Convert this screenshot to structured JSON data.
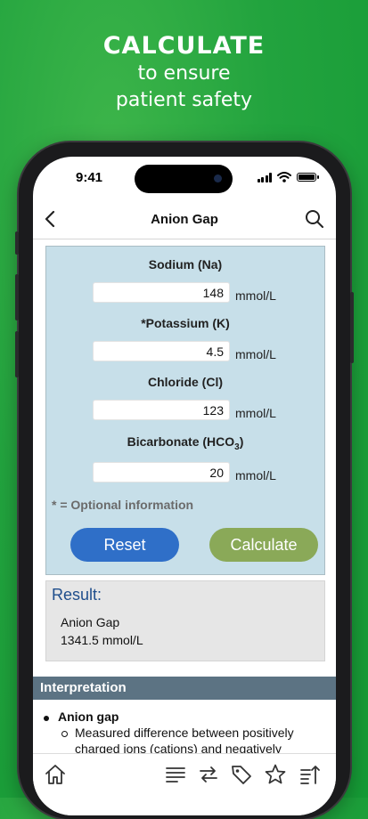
{
  "promo": {
    "headline": "CALCULATE",
    "line1": "to ensure",
    "line2": "patient safety"
  },
  "status_bar": {
    "time": "9:41"
  },
  "nav": {
    "title": "Anion Gap",
    "back_icon": "chevron-left-icon",
    "search_icon": "search-icon"
  },
  "form": {
    "fields": [
      {
        "label": "Sodium (Na)",
        "value": "148",
        "unit": "mmol/L"
      },
      {
        "label": "*Potassium (K)",
        "value": "4.5",
        "unit": "mmol/L"
      },
      {
        "label": "Chloride (Cl)",
        "value": "123",
        "unit": "mmol/L"
      },
      {
        "label": "Bicarbonate (HCO",
        "label_sub": "3",
        "label_end": ")",
        "value": "20",
        "unit": "mmol/L"
      }
    ],
    "optional_note": "* = Optional information",
    "reset_label": "Reset",
    "calculate_label": "Calculate",
    "colors": {
      "panel": "#c7dfe9",
      "reset": "#2f6fc8",
      "calculate": "#8aa958"
    }
  },
  "result": {
    "title": "Result:",
    "label": "Anion Gap",
    "value": "1341.5 mmol/L"
  },
  "interpretation": {
    "header": "Interpretation",
    "item_title": "Anion gap",
    "item_text": "Measured difference between positively charged ions (cations) and negatively"
  },
  "tabbar": {
    "icons": [
      "home-icon",
      "list-icon",
      "swap-icon",
      "tag-icon",
      "star-icon",
      "sort-icon"
    ]
  },
  "colors": {
    "background": "#22a33e",
    "section_header": "#5c7383",
    "result_title": "#1f4e8c"
  }
}
